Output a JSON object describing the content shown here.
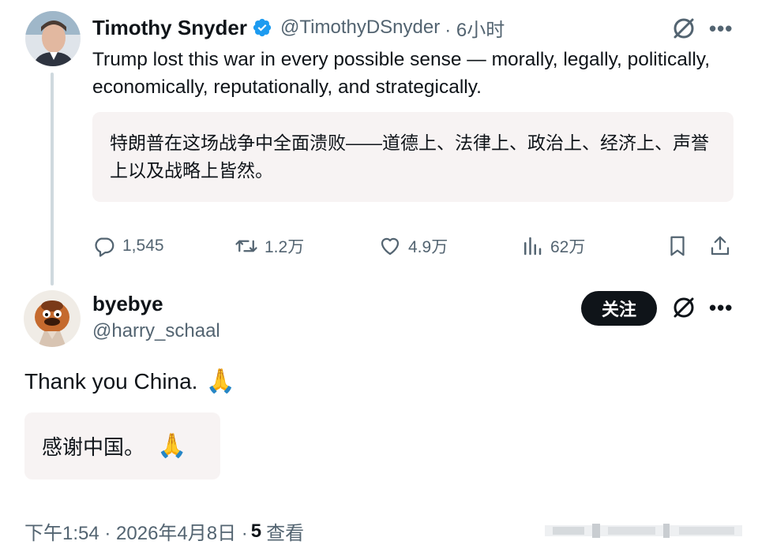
{
  "tweet": {
    "author_name": "Timothy Snyder",
    "handle": "@TimothyDSnyder",
    "time": "· 6小时",
    "text": "Trump lost this war in every possible sense — morally, legally, politically, economically, reputationally, and strategically.",
    "translation": "特朗普在这场战争中全面溃败——道德上、法律上、政治上、经济上、声誉上以及战略上皆然。",
    "stats": {
      "replies": "1,545",
      "reposts": "1.2万",
      "likes": "4.9万",
      "views": "62万"
    }
  },
  "reply": {
    "author_name": "byebye",
    "handle": "@harry_schaal",
    "follow_label": "关注",
    "text": "Thank you China.",
    "emoji": "🙏",
    "translation": "感谢中国。",
    "meta": {
      "time": "下午1:54 · 2026年4月8日 ·",
      "view_count": "5",
      "view_label": "查看"
    }
  },
  "colors": {
    "text": "#0f1419",
    "secondary": "#536471",
    "verified": "#1d9bf0",
    "translation_bg": "#f7f3f3",
    "follow_bg": "#0f1419"
  },
  "icons": [
    "verified-badge-icon",
    "grok-icon",
    "more-icon",
    "reply-icon",
    "repost-icon",
    "like-icon",
    "views-icon",
    "bookmark-icon",
    "share-icon"
  ]
}
